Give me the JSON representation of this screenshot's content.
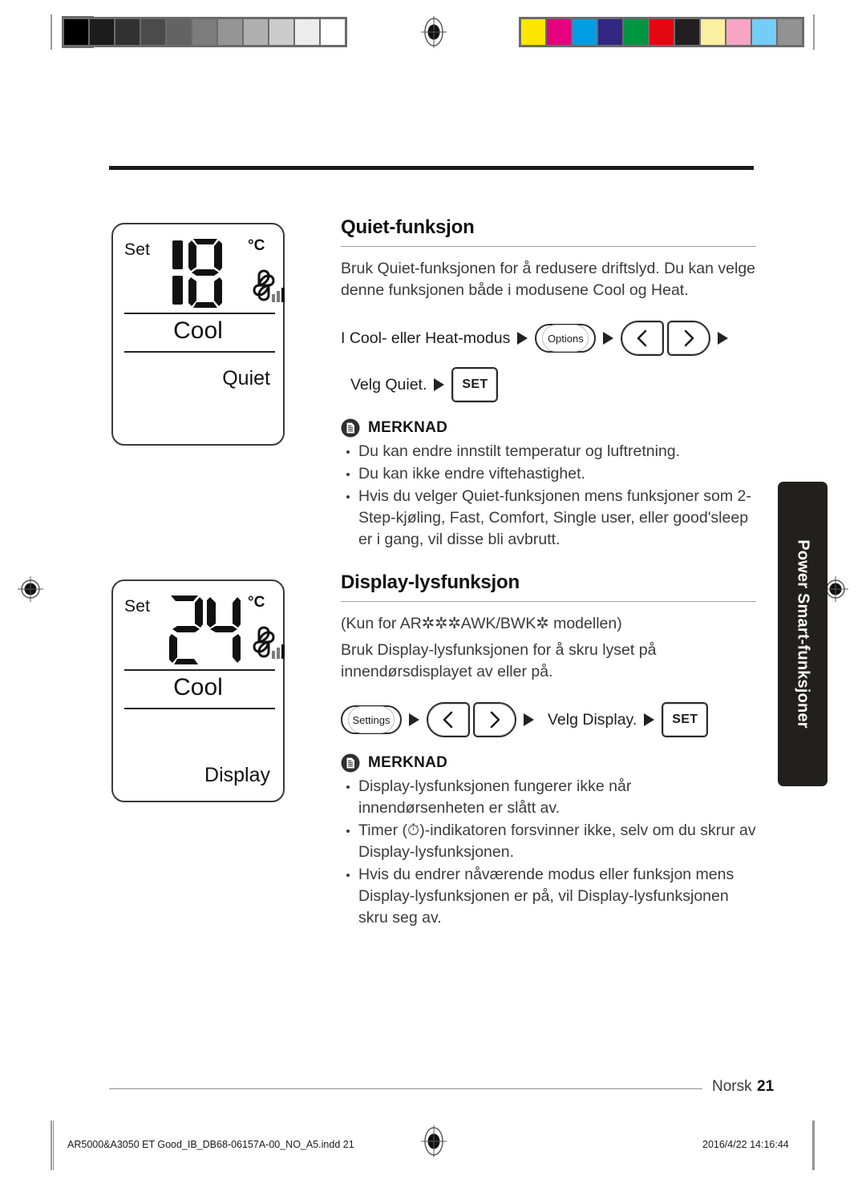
{
  "calibration": {
    "gray_bar": [
      "#000000",
      "#1c1c1c",
      "#323232",
      "#4b4b4b",
      "#636363",
      "#7c7c7c",
      "#959595",
      "#b0b0b0",
      "#cccccc",
      "#ececec",
      "#ffffff"
    ],
    "color_bar": [
      "#ffe600",
      "#e6007e",
      "#009fe3",
      "#312783",
      "#009640",
      "#e30613",
      "#231f20",
      "#fbefa0",
      "#f6a6c4",
      "#74cdf5",
      "#929292"
    ]
  },
  "lcd_panels": [
    {
      "id": "quiet",
      "set_label": "Set",
      "temperature": "18",
      "unit": "°C",
      "mode": "Cool",
      "function": "Quiet",
      "fan_icon": "fan-icon",
      "fan_bars": 3
    },
    {
      "id": "display",
      "set_label": "Set",
      "temperature": "24",
      "unit": "°C",
      "mode": "Cool",
      "function": "Display",
      "fan_icon": "fan-icon",
      "fan_bars": 3
    }
  ],
  "sections": [
    {
      "id": "quiet",
      "heading": "Quiet-funksjon",
      "intro": "Bruk Quiet-funksjonen for å redusere driftslyd. Du kan velge denne funksjonen både i modusene Cool og Heat.",
      "steps_line1": {
        "text": "I Cool- eller  Heat-modus",
        "button": "Options"
      },
      "steps_line2": {
        "text": "Velg Quiet.",
        "button": "SET"
      },
      "note_label": "MERKNAD",
      "notes": [
        "Du kan endre innstilt temperatur og luftretning.",
        "Du kan ikke endre viftehastighet.",
        "Hvis du velger Quiet-funksjonen mens funksjoner som 2-Step-kjøling, Fast, Comfort, Single user, eller good'sleep er i gang, vil disse bli avbrutt."
      ]
    },
    {
      "id": "display",
      "heading": "Display-lysfunksjon",
      "model_note": "(Kun for AR✲✲✲AWK/BWK✲ modellen)",
      "intro": "Bruk Display-lysfunksjonen for å skru lyset på innendørsdisplayet av eller på.",
      "steps_line1": {
        "button_settings": "Settings",
        "text": "Velg Display.",
        "button_set": "SET"
      },
      "note_label": "MERKNAD",
      "notes": [
        "Display-lysfunksjonen fungerer ikke når innendørsenheten er slått av.",
        "Timer (⏱)-indikatoren forsvinner ikke, selv om du skrur av Display-lysfunksjonen.",
        "Hvis du endrer nåværende modus eller funksjon mens Display-lysfunksjonen er på, vil  Display-lysfunksjonen skru seg av."
      ]
    }
  ],
  "side_tab": {
    "label": "Power Smart-funksjoner",
    "background": "#221f1f"
  },
  "footer": {
    "language": "Norsk",
    "page_number": "21"
  },
  "imprint": {
    "file": "AR5000&A3050 ET Good_IB_DB68-06157A-00_NO_A5.indd  21",
    "datetime": "2016/4/22  14:16:44"
  }
}
